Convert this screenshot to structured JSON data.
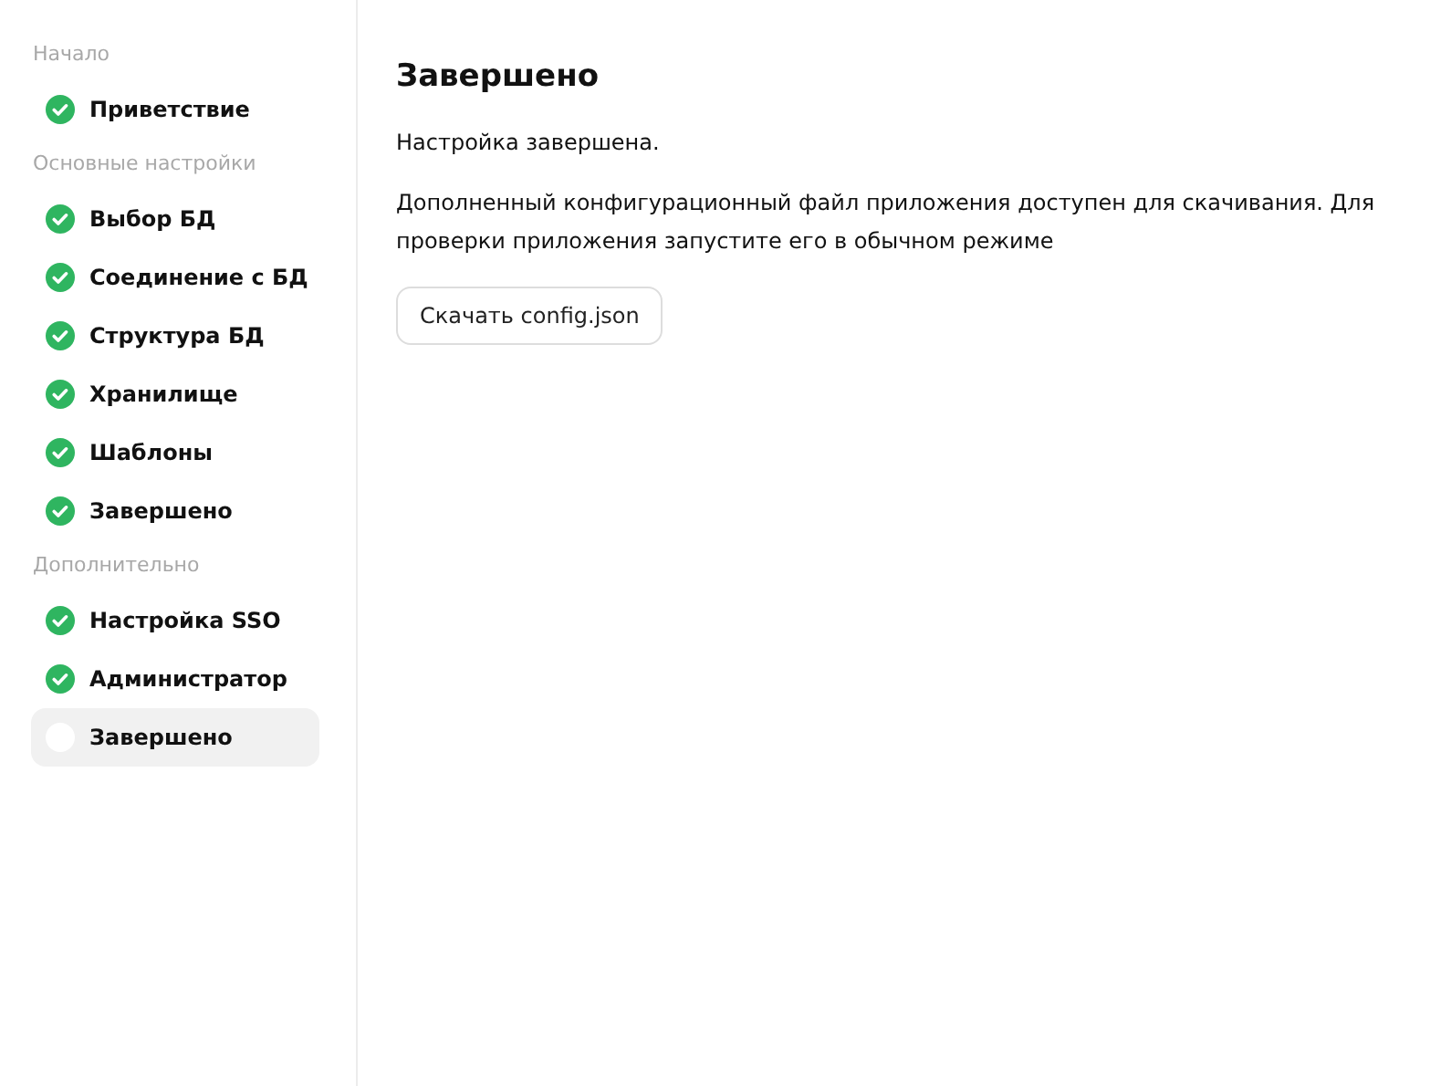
{
  "sidebar": {
    "sections": [
      {
        "title": "Начало",
        "items": [
          {
            "label": "Приветствие",
            "done": true,
            "selected": false
          }
        ]
      },
      {
        "title": "Основные настройки",
        "items": [
          {
            "label": "Выбор БД",
            "done": true,
            "selected": false
          },
          {
            "label": "Соединение с БД",
            "done": true,
            "selected": false
          },
          {
            "label": "Структура БД",
            "done": true,
            "selected": false
          },
          {
            "label": "Хранилище",
            "done": true,
            "selected": false
          },
          {
            "label": "Шаблоны",
            "done": true,
            "selected": false
          },
          {
            "label": "Завершено",
            "done": true,
            "selected": false
          }
        ]
      },
      {
        "title": "Дополнительно",
        "items": [
          {
            "label": "Настройка SSO",
            "done": true,
            "selected": false
          },
          {
            "label": "Администратор",
            "done": true,
            "selected": false
          },
          {
            "label": "Завершено",
            "done": false,
            "selected": true
          }
        ]
      }
    ]
  },
  "main": {
    "title": "Завершено",
    "paragraphs": [
      "Настройка завершена.",
      "Дополненный конфигурационный файл приложения доступен для скачивания. Для проверки приложения запустите его в обычном режиме"
    ],
    "button": "Скачать config.json"
  }
}
